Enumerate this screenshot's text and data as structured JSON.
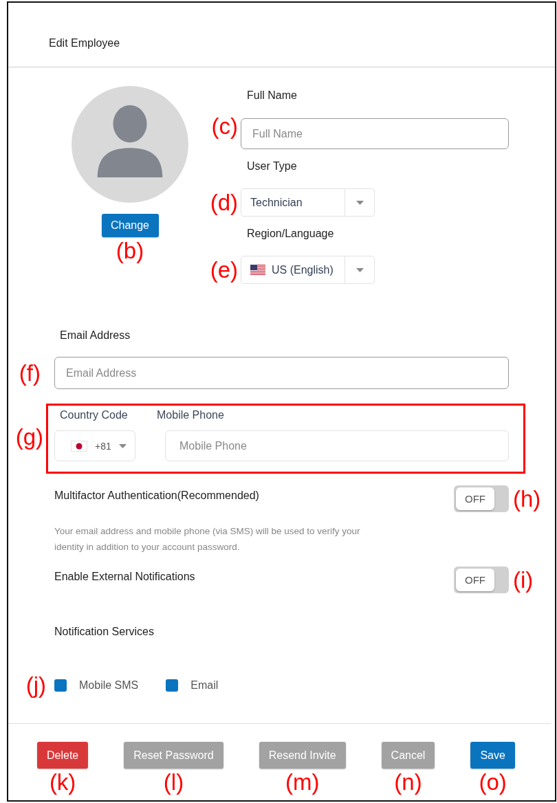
{
  "window": {
    "title": "Edit Employee"
  },
  "photo": {
    "button": "Change",
    "annotation": "(b)"
  },
  "full_name": {
    "label": "Full Name",
    "placeholder": "Full Name",
    "annotation": "(c)"
  },
  "user_type": {
    "label": "User Type",
    "value": "Technician",
    "annotation": "(d)"
  },
  "region": {
    "label": "Region/Language",
    "value": "US (English)",
    "annotation": "(e)"
  },
  "email": {
    "label": "Email Address",
    "placeholder": "Email Address",
    "annotation": "(f)"
  },
  "phone": {
    "country_label": "Country Code",
    "country_value": "+81",
    "label": "Mobile Phone",
    "placeholder": "Mobile Phone",
    "annotation": "(g)"
  },
  "mfa": {
    "label": "Multifactor Authentication(Recommended)",
    "on": false,
    "toggle_text": "OFF",
    "annotation": "(h)",
    "description": "Your email address and mobile phone (via SMS) will be used to verify your identity in addition to your account password."
  },
  "external_notifications": {
    "label": "Enable External Notifications",
    "on": false,
    "toggle_text": "OFF",
    "annotation": "(i)"
  },
  "notification_services": {
    "label": "Notification Services",
    "annotation": "(j)",
    "options": [
      {
        "label": "Mobile SMS",
        "checked": true
      },
      {
        "label": "Email",
        "checked": true
      }
    ]
  },
  "buttons": [
    {
      "label": "Delete",
      "kind": "danger",
      "annotation": "(k)"
    },
    {
      "label": "Reset Password",
      "kind": "secondary",
      "annotation": "(l)"
    },
    {
      "label": "Resend Invite",
      "kind": "secondary",
      "annotation": "(m)"
    },
    {
      "label": "Cancel",
      "kind": "secondary",
      "annotation": "(n)"
    },
    {
      "label": "Save",
      "kind": "primary",
      "annotation": "(o)"
    }
  ]
}
